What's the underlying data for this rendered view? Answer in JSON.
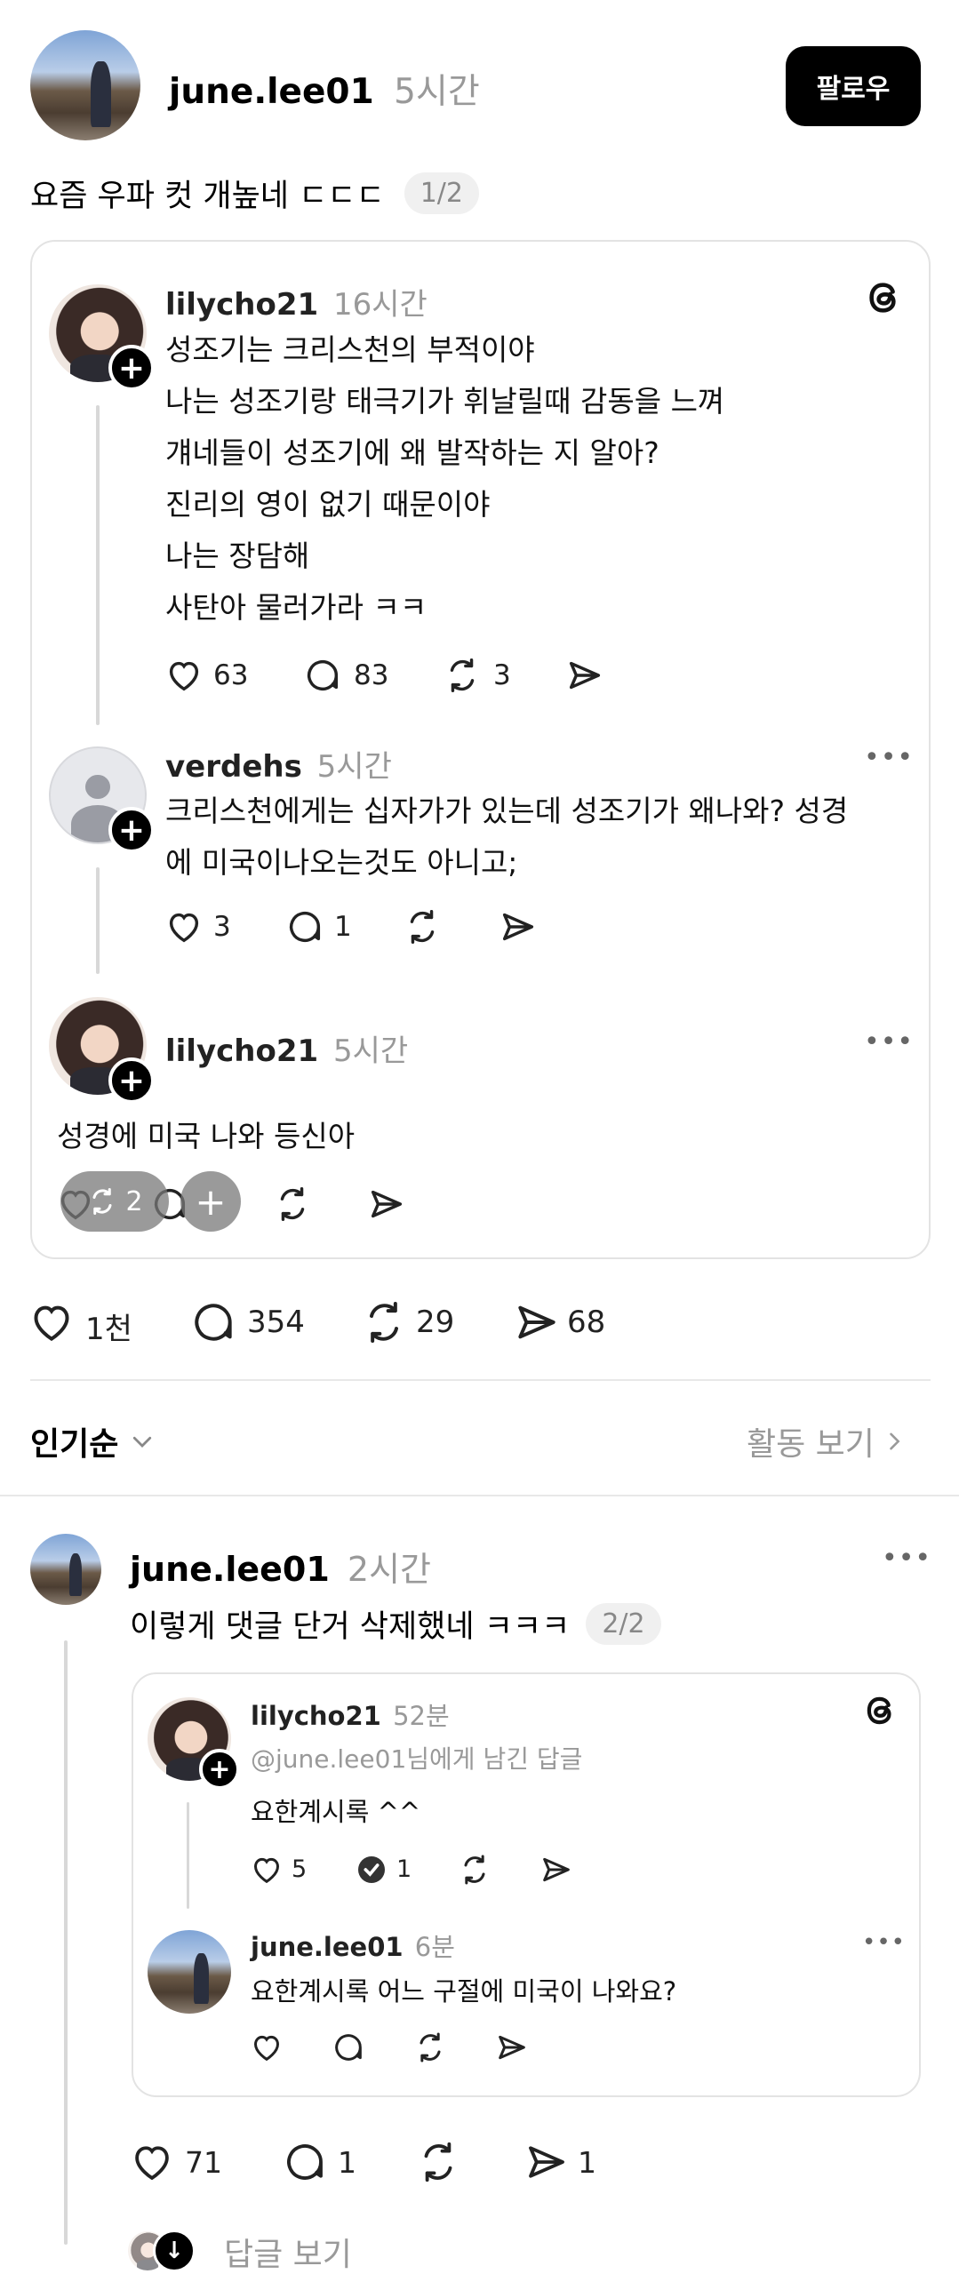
{
  "post": {
    "author": "june.lee01",
    "time": "5시간",
    "follow_label": "팔로우",
    "text": "요즘 우파 컷 개높네 ㄷㄷㄷ",
    "page_indicator": "1/2",
    "likes": "1천",
    "comments": "354",
    "reposts": "29",
    "shares": "68"
  },
  "quoted_thread": {
    "posts": [
      {
        "author": "lilycho21",
        "time": "16시간",
        "lines": [
          "성조기는 크리스천의 부적이야",
          "나는 성조기랑 태극기가 휘날릴때 감동을 느껴",
          "걔네들이 성조기에 왜 발작하는 지 알아?",
          "진리의 영이 없기 때문이야",
          "나는 장담해",
          "사탄아 물러가라 ㅋㅋ"
        ],
        "likes": "63",
        "comments": "83",
        "reposts": "3"
      },
      {
        "author": "verdehs",
        "time": "5시간",
        "lines": [
          "크리스천에게는 십자가가 있는데 성조기가 왜나와? 성경",
          "에 미국이나오는것도 아니고;"
        ],
        "likes": "3",
        "comments": "1"
      },
      {
        "author": "lilycho21",
        "time": "5시간",
        "lines": [
          "성경에 미국 나와 등신아"
        ],
        "overlay_count": "2"
      }
    ]
  },
  "sort": {
    "label": "인기순",
    "activity_label": "활동 보기"
  },
  "reply": {
    "author": "june.lee01",
    "time": "2시간",
    "text": "이렇게 댓글 단거 삭제했네 ㅋㅋㅋ",
    "page_indicator": "2/2",
    "likes": "71",
    "comments": "1",
    "shares": "1",
    "view_replies_label": "답글 보기",
    "quoted": {
      "first": {
        "author": "lilycho21",
        "time": "52분",
        "reply_to": "@june.lee01님에게 남긴 답글",
        "text": "요한계시록 ^^",
        "likes": "5",
        "comments": "1"
      },
      "second": {
        "author": "june.lee01",
        "time": "6분",
        "text": "요한계시록 어느 구절에 미국이 나와요?"
      }
    }
  },
  "colors": {
    "text": "#000000",
    "muted": "#999999",
    "border": "#e3e3e3",
    "button_bg": "#000000"
  }
}
